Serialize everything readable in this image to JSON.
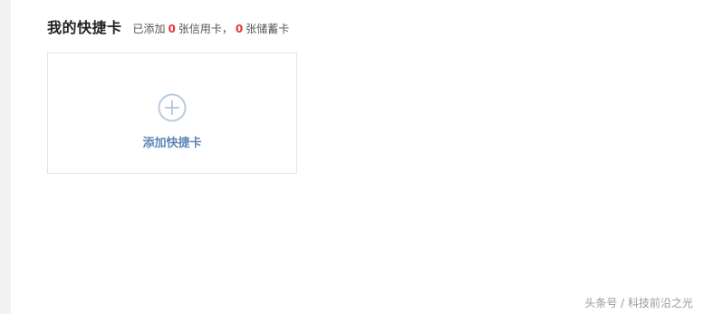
{
  "header": {
    "title": "我的快捷卡",
    "added_prefix": "已添加",
    "credit_count": "0",
    "credit_label": "张信用卡，",
    "debit_count": "0",
    "debit_label": "张储蓄卡"
  },
  "add_card": {
    "icon": "plus-circle-icon",
    "label": "添加快捷卡"
  },
  "watermark": {
    "text": "头条号 / 科技前沿之光"
  },
  "colors": {
    "count_highlight": "#e4393c",
    "link_blue": "#5e87b6",
    "icon_gray_blue": "#b9cde0",
    "card_border": "#e4e4e4"
  }
}
